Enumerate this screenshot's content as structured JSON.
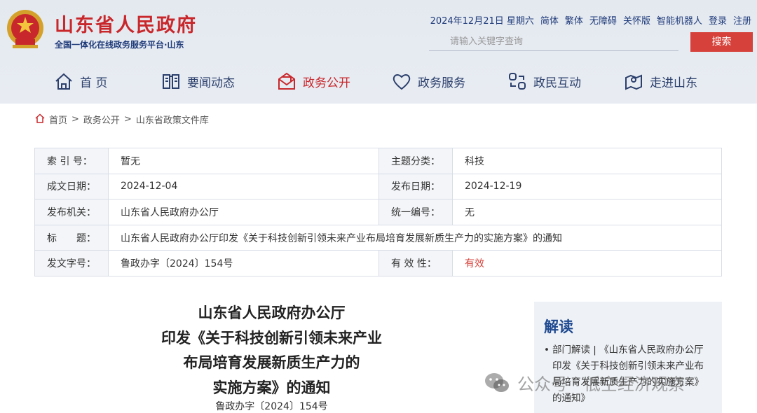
{
  "header": {
    "title": "山东省人民政府",
    "subtitle": "全国一体化在线政务服务平台·山东",
    "topbar": [
      "2024年12月21日 星期六",
      "简体",
      "繁体",
      "无障碍",
      "关怀版",
      "智能机器人",
      "登录",
      "注册"
    ],
    "search_placeholder": "请输入关键字查询",
    "search_button": "搜索"
  },
  "nav": [
    {
      "label": "首 页",
      "icon": "home-icon"
    },
    {
      "label": "要闻动态",
      "icon": "news-icon"
    },
    {
      "label": "政务公开",
      "icon": "mail-icon"
    },
    {
      "label": "政务服务",
      "icon": "heart-icon"
    },
    {
      "label": "政民互动",
      "icon": "interaction-icon"
    },
    {
      "label": "走进山东",
      "icon": "location-icon"
    }
  ],
  "breadcrumb": [
    "首页",
    "政务公开",
    "山东省政策文件库"
  ],
  "meta": {
    "index_label": "索 引 号：",
    "index_value": "暂无",
    "topic_label": "主题分类：",
    "topic_value": "科技",
    "date_label": "成文日期：",
    "date_value": "2024-12-04",
    "publish_label": "发布日期：",
    "publish_value": "2024-12-19",
    "org_label": "发布机关：",
    "org_value": "山东省人民政府办公厅",
    "code_label": "统一编号：",
    "code_value": "无",
    "title_label": "标　　题：",
    "title_value": "山东省人民政府办公厅印发《关于科技创新引领未来产业布局培育发展新质生产力的实施方案》的通知",
    "docno_label": "发文字号：",
    "docno_value": "鲁政办字〔2024〕154号",
    "valid_label": "有 效 性：",
    "valid_value": "有效"
  },
  "doc": {
    "title_lines": [
      "山东省人民政府办公厅",
      "印发《关于科技创新引领未来产业",
      "布局培育发展新质生产力的",
      "实施方案》的通知"
    ],
    "number": "鲁政办字〔2024〕154号"
  },
  "sidebar": {
    "title": "解读",
    "link": "部门解读 | 《山东省人民政府办公厅印发《关于科技创新引领未来产业布局培育发展新质生产力的实施方案》的通知》"
  },
  "watermark": "公众号 · 低空经济观察",
  "colors": {
    "accent_red": "#c8282c",
    "navy": "#1f3b7a",
    "header_bg": "#e6eaf0"
  }
}
